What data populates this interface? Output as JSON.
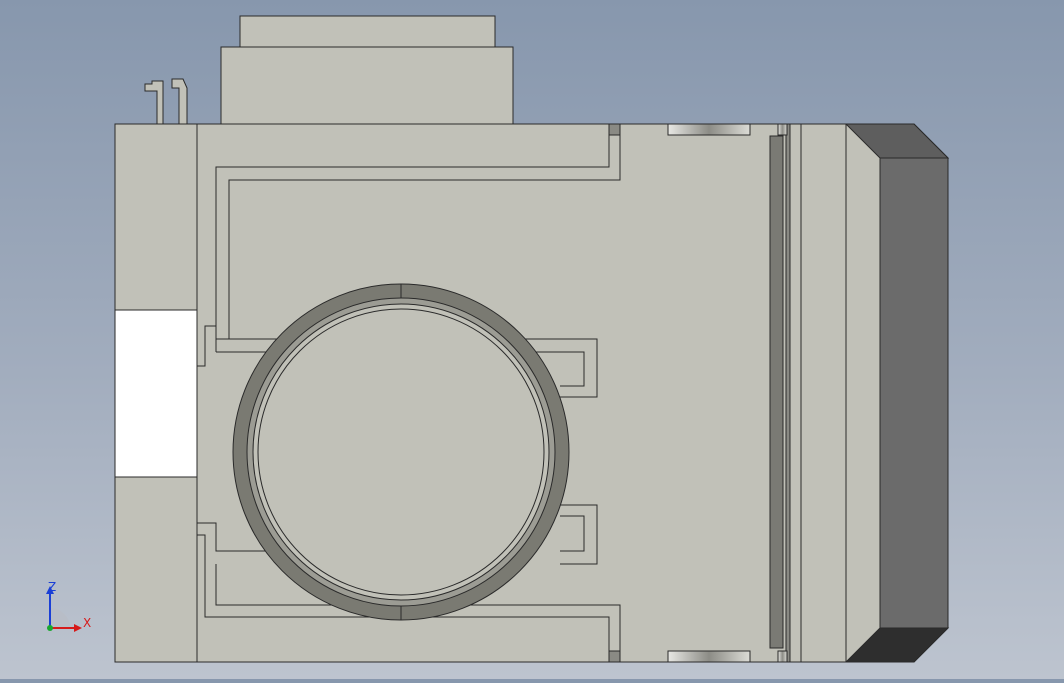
{
  "viewport": {
    "background_top": "#8797ad",
    "background_bottom": "#bdc4cf",
    "part_color": "#c1c1b8",
    "edge_color": "#2a2a2a",
    "dark_face_color": "#6b6b6b",
    "darker_face_color": "#3a3a3a"
  },
  "triad": {
    "z_label": "Z",
    "x_label": "X",
    "z_color": "#1a3fd6",
    "x_color": "#d61a1a",
    "origin_color": "#19a82e"
  }
}
